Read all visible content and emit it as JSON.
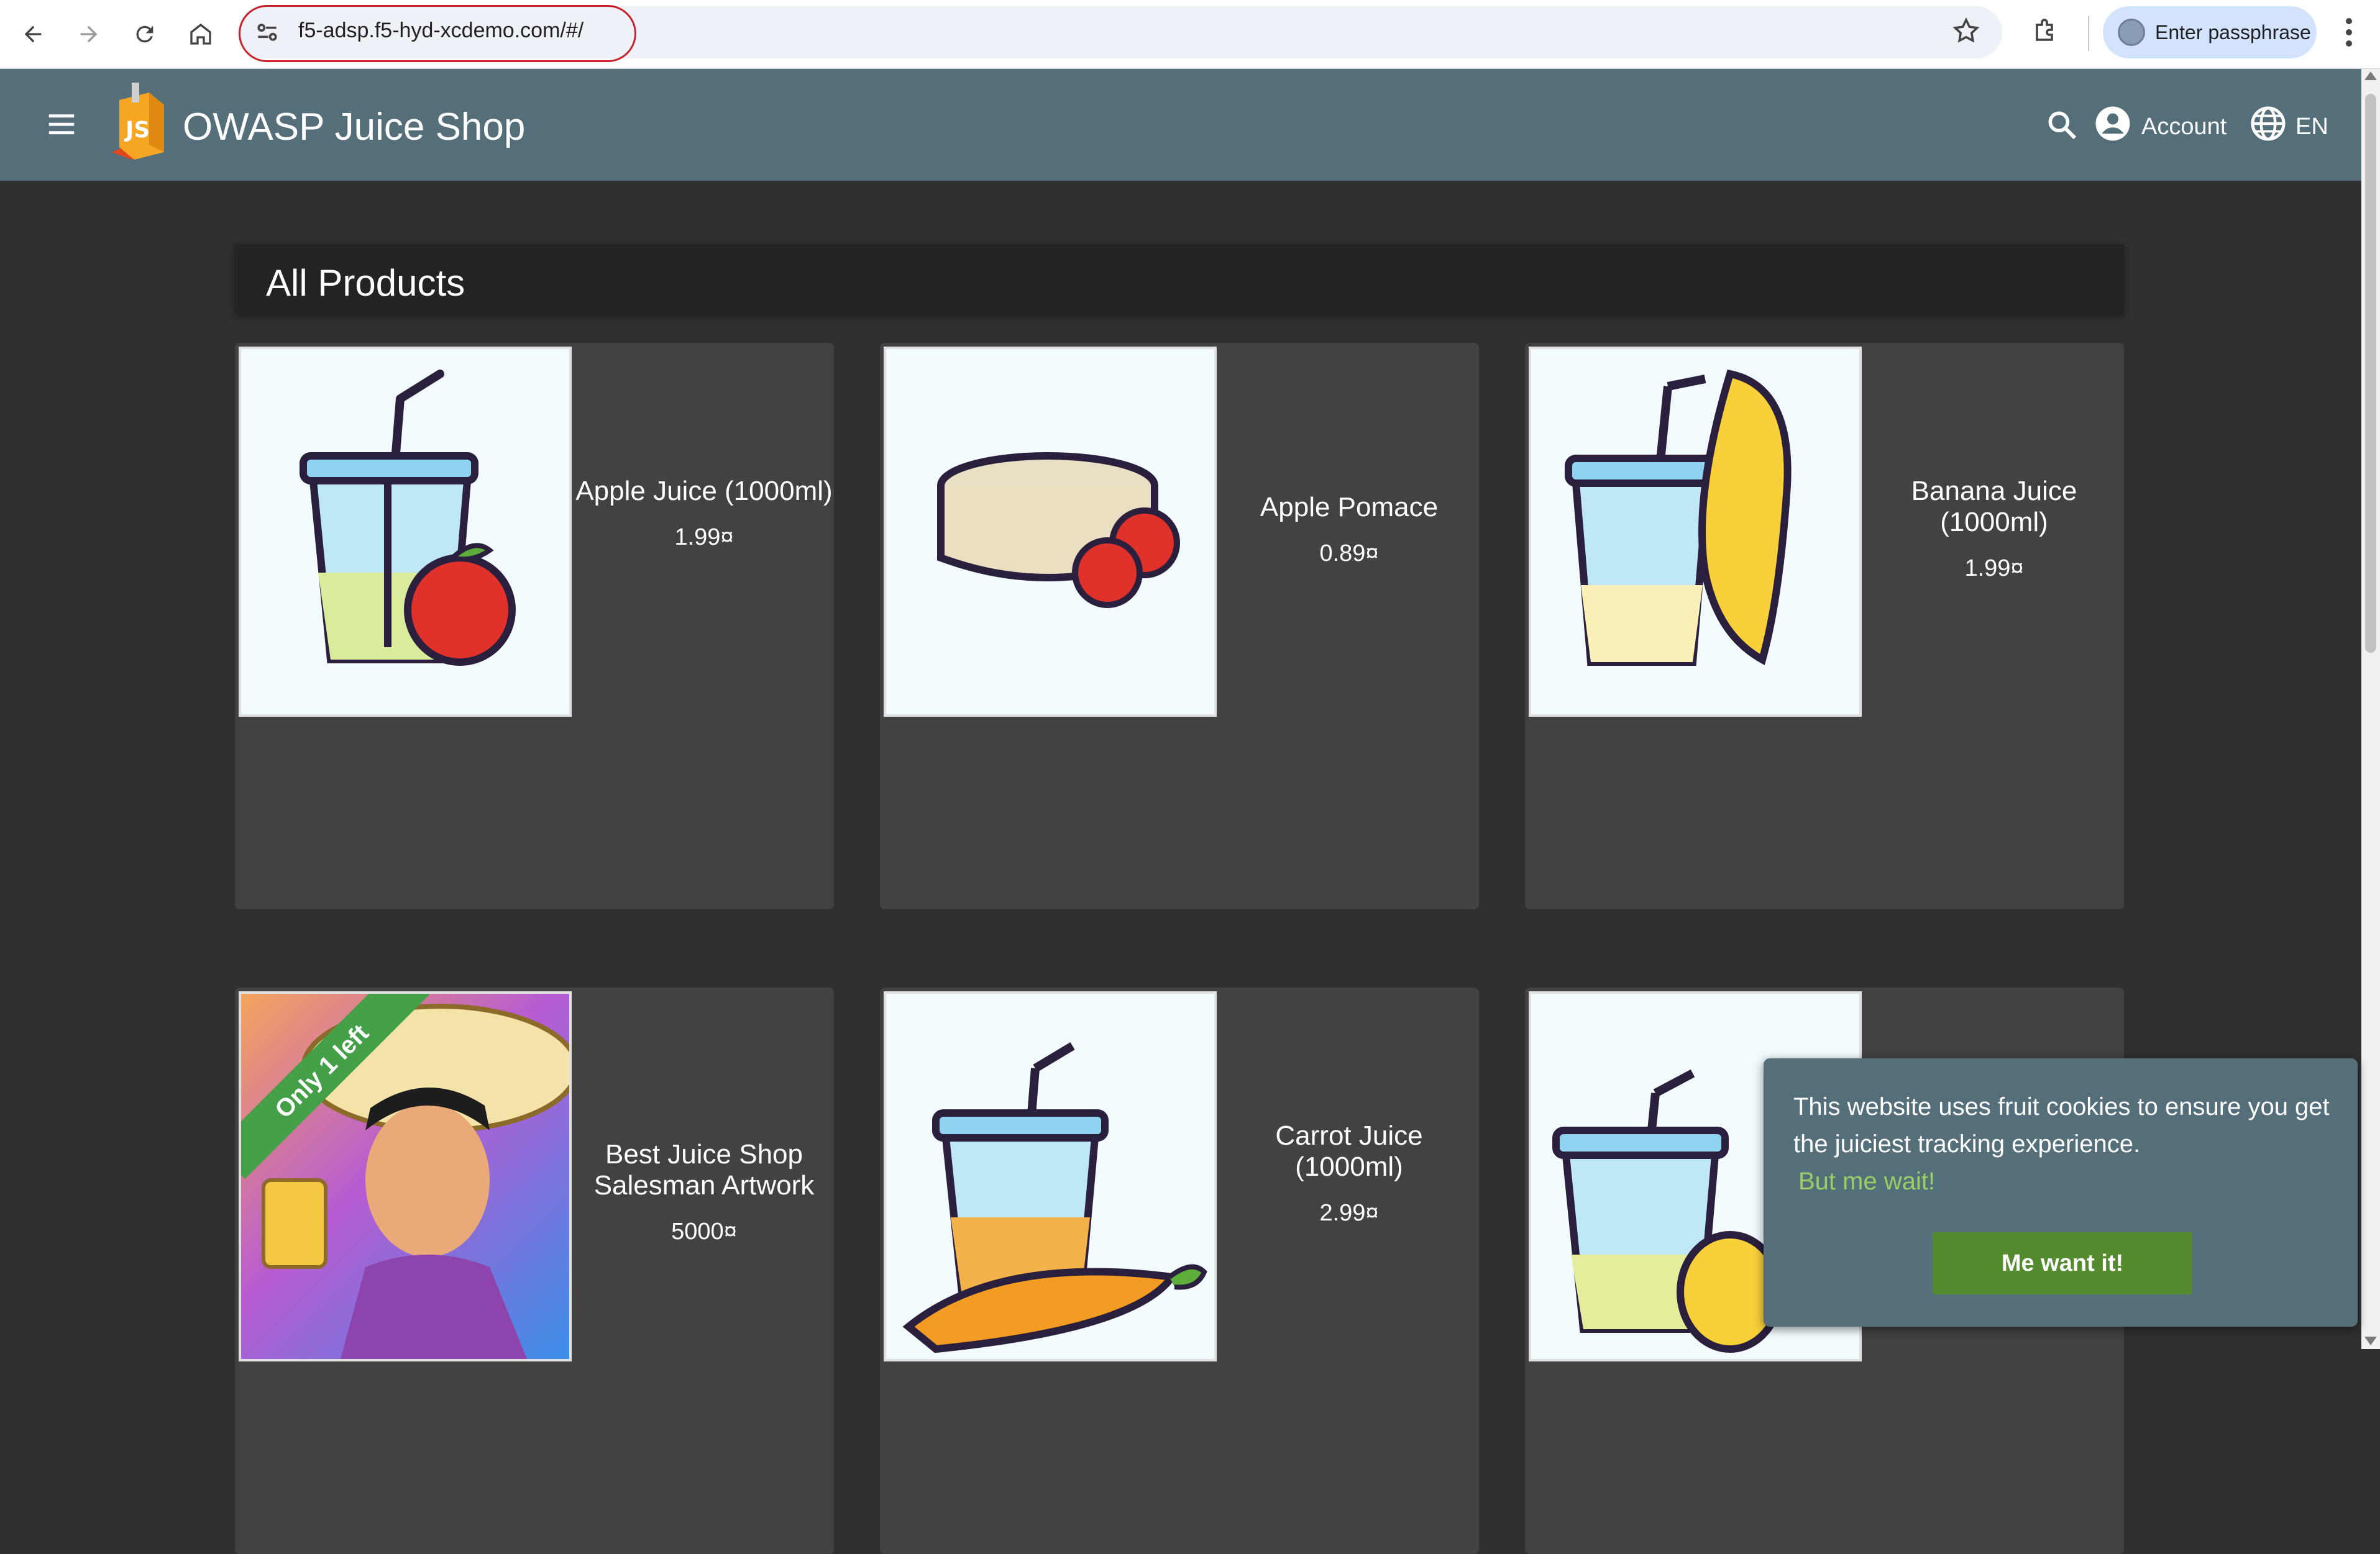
{
  "browser": {
    "url": "f5-adsp.f5-hyd-xcdemo.com/#/",
    "passphrase_label": "Enter passphrase"
  },
  "app": {
    "title": "OWASP Juice Shop",
    "logo_text": "JS",
    "account_label": "Account",
    "language_label": "EN"
  },
  "section": {
    "title": "All Products"
  },
  "products": [
    {
      "name": "Apple Juice (1000ml)",
      "price": "1.99¤",
      "image": "apple-juice-image"
    },
    {
      "name": "Apple Pomace",
      "price": "0.89¤",
      "image": "apple-pomace-image"
    },
    {
      "name": "Banana Juice (1000ml)",
      "price": "1.99¤",
      "image": "banana-juice-image"
    },
    {
      "name": "Best Juice Shop Salesman Artwork",
      "price": "5000¤",
      "image": "salesman-artwork-image",
      "ribbon": "Only 1 left"
    },
    {
      "name": "Carrot Juice (1000ml)",
      "price": "2.99¤",
      "image": "carrot-juice-image"
    },
    {
      "name": "",
      "price": "",
      "image": "lemon-juice-image"
    }
  ],
  "cookie": {
    "message": "This website uses fruit cookies to ensure you get the juiciest tracking experience.",
    "link": "But me wait!",
    "button": "Me want it!"
  },
  "colors": {
    "toolbar": "#546e7a",
    "background": "#303030",
    "card": "#424242",
    "accent_green": "#558b2f"
  }
}
